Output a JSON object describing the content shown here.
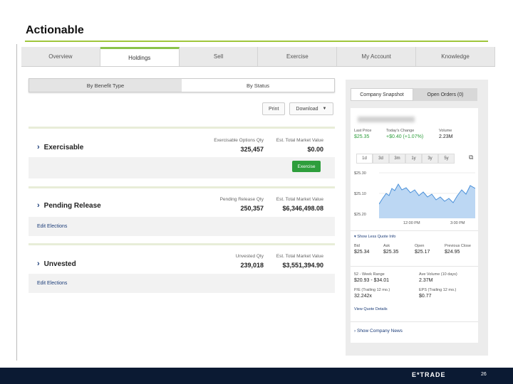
{
  "slide": {
    "title": "Actionable",
    "page_number": "26",
    "brand": "E*TRADE"
  },
  "nav": {
    "tabs": [
      "Overview",
      "Holdings",
      "Sell",
      "Exercise",
      "My Account",
      "Knowledge"
    ]
  },
  "filters": {
    "by_benefit": "By Benefit Type",
    "by_status": "By Status",
    "print": "Print",
    "download": "Download"
  },
  "cards": {
    "exercisable": {
      "name": "Exercisable",
      "qty_label": "Exercisable Options Qty",
      "qty": "325,457",
      "mv_label": "Est. Total Market Value",
      "mv": "$0.00",
      "action": "Exercise"
    },
    "pending": {
      "name": "Pending Release",
      "qty_label": "Pending Release Qty",
      "qty": "250,357",
      "mv_label": "Est. Total Market Value",
      "mv": "$6,346,498.08",
      "link": "Edit Elections"
    },
    "unvested": {
      "name": "Unvested",
      "qty_label": "Unvested Qty",
      "qty": "239,018",
      "mv_label": "Est. Total Market Value",
      "mv": "$3,551,394.90",
      "link": "Edit Elections"
    }
  },
  "snapshot": {
    "tabs": [
      "Company Snapshot",
      "Open Orders (0)"
    ],
    "last_price_label": "Last Price",
    "last_price": "$25.35",
    "change_label": "Today's Change",
    "change": "+$0.40 (+1.07%)",
    "volume_label": "Volume",
    "volume": "2.23M",
    "ranges": [
      "1d",
      "3d",
      "3m",
      "1y",
      "3y",
      "5y"
    ],
    "y_ticks": [
      "$25.30",
      "$25.10",
      "$25.20"
    ],
    "x_ticks": [
      "12:00 PM",
      "3:00 PM"
    ],
    "show_less": "Show Less Quote Info",
    "bid_label": "Bid",
    "bid": "$25.34",
    "ask_label": "Ask",
    "ask": "$25.35",
    "open_label": "Open",
    "open": "$25.17",
    "prev_label": "Previous Close",
    "prev": "$24.95",
    "wk_label": "52 - Week Range",
    "wk": "$20.93 - $34.01",
    "avgvol_label": "Ave Volume (10 days)",
    "avgvol": "2.37M",
    "pe_label": "P/E (Trailing 12 mo.)",
    "pe": "32.242x",
    "eps_label": "EPS (Trailing 12 mo.)",
    "eps": "$0.77",
    "quote_details": "View Quote Details",
    "company_news": "Show Company News",
    "colors": {
      "line": "#4a90d9",
      "fill": "#bcd7f3"
    }
  }
}
